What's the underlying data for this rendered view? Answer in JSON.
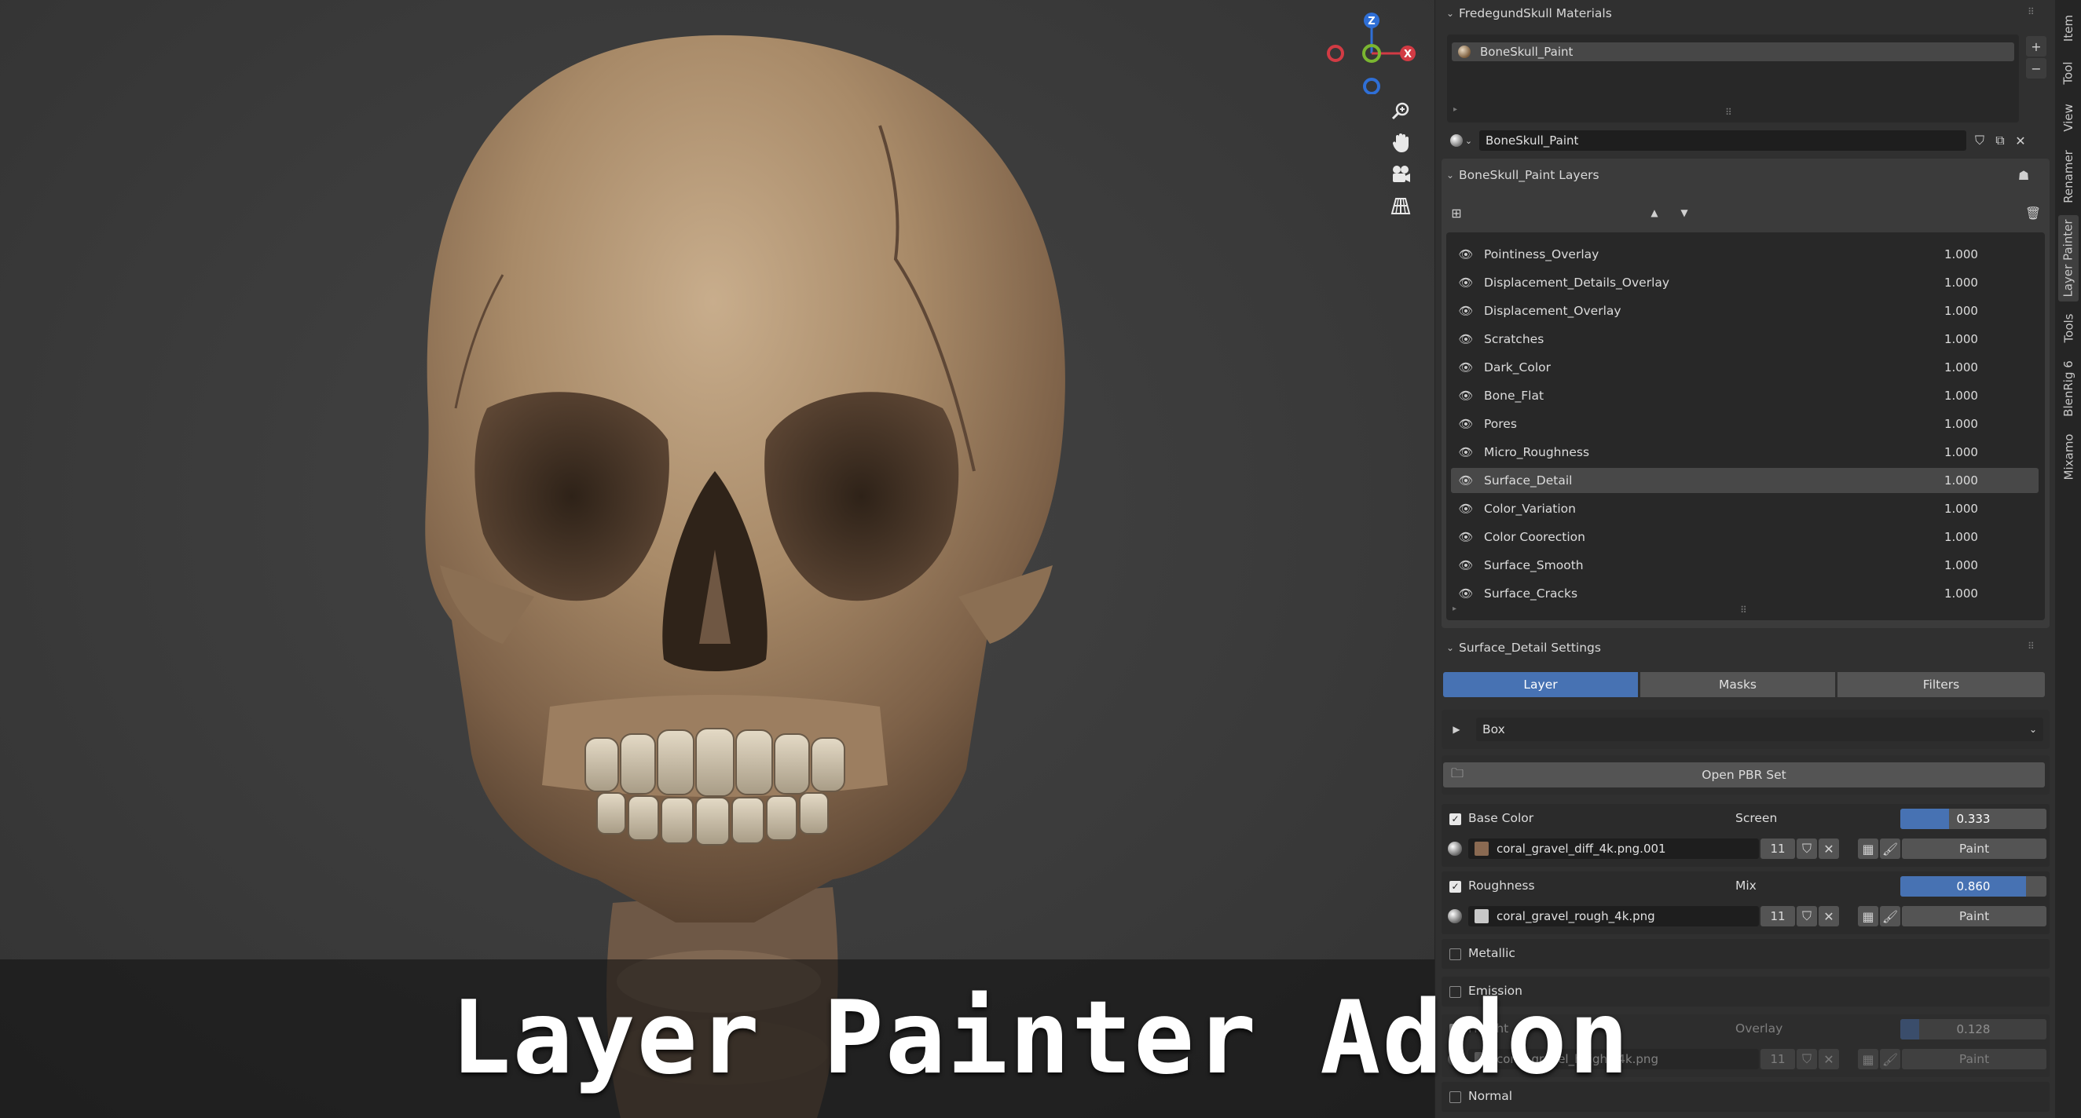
{
  "caption": "Layer Painter Addon",
  "gizmo": {
    "z_label": "Z",
    "x_label": "X"
  },
  "viewport_tools": [
    "zoom-icon",
    "hand-pan-icon",
    "camera-icon",
    "grid-perspective-icon"
  ],
  "materials": {
    "title": "FredegundSkull Materials",
    "slots": [
      "BoneSkull_Paint"
    ],
    "active_material": "BoneSkull_Paint",
    "add": "+",
    "remove": "−"
  },
  "layers_section": {
    "title": "BoneSkull_Paint Layers",
    "layers": [
      {
        "name": "Pointiness_Overlay",
        "value": "1.000"
      },
      {
        "name": "Displacement_Details_Overlay",
        "value": "1.000"
      },
      {
        "name": "Displacement_Overlay",
        "value": "1.000"
      },
      {
        "name": "Scratches",
        "value": "1.000"
      },
      {
        "name": "Dark_Color",
        "value": "1.000"
      },
      {
        "name": "Bone_Flat",
        "value": "1.000"
      },
      {
        "name": "Pores",
        "value": "1.000"
      },
      {
        "name": "Micro_Roughness",
        "value": "1.000"
      },
      {
        "name": "Surface_Detail",
        "value": "1.000",
        "active": true
      },
      {
        "name": "Color_Variation",
        "value": "1.000"
      },
      {
        "name": "Color Coorection",
        "value": "1.000"
      },
      {
        "name": "Surface_Smooth",
        "value": "1.000"
      },
      {
        "name": "Surface_Cracks",
        "value": "1.000"
      }
    ]
  },
  "settings": {
    "title": "Surface_Detail Settings",
    "tabs": [
      "Layer",
      "Masks",
      "Filters"
    ],
    "active_tab": "Layer",
    "projection": "Box",
    "open_pbr": "Open PBR Set",
    "channels": [
      {
        "name": "Base Color",
        "enabled": true,
        "blend": "Screen",
        "opacity": 0.333,
        "opacity_label": "0.333",
        "texture": "coral_gravel_diff_4k.png.001",
        "users": "11",
        "paint": "Paint",
        "swatch": "#8a6a52"
      },
      {
        "name": "Roughness",
        "enabled": true,
        "blend": "Mix",
        "opacity": 0.86,
        "opacity_label": "0.860",
        "texture": "coral_gravel_rough_4k.png",
        "users": "11",
        "paint": "Paint",
        "swatch": "#c8c8c8"
      },
      {
        "name": "Metallic",
        "enabled": false
      },
      {
        "name": "Emission",
        "enabled": false
      },
      {
        "name": "Height",
        "enabled": true,
        "blend": "Overlay",
        "opacity": 0.128,
        "opacity_label": "0.128",
        "texture": "coral_gravel_height_4k.png",
        "users": "11",
        "paint": "Paint",
        "swatch": "#8a8a8a"
      },
      {
        "name": "Normal",
        "enabled": false
      }
    ]
  },
  "side_tabs": [
    "Item",
    "Tool",
    "View",
    "Renamer",
    "Layer Painter",
    "Tools",
    "BlenRig 6",
    "Mixamo"
  ],
  "active_side_tab": "Layer Painter",
  "colors": {
    "accent": "#4772b3",
    "panel_bg": "#303030",
    "viewport_bg": "#3a3a3a"
  }
}
